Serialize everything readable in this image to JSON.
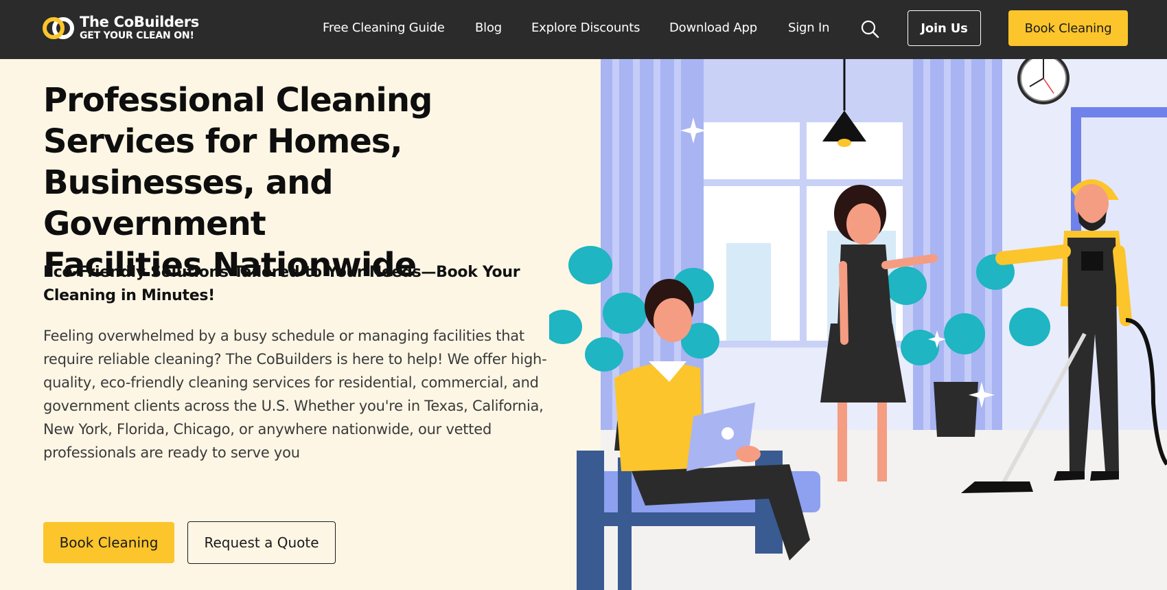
{
  "brand": {
    "name": "The CoBuilders",
    "tagline": "GET YOUR CLEAN ON!",
    "accent_color": "#fbc52b",
    "header_bg": "#2b2b2b",
    "page_bg": "#fdf6e5"
  },
  "nav": {
    "links": [
      "Free Cleaning Guide",
      "Blog",
      "Explore Discounts",
      "Download App",
      "Sign In"
    ],
    "search_icon": "search-icon",
    "join_label": "Join Us",
    "book_label": "Book Cleaning"
  },
  "hero": {
    "title_lines": [
      "Professional Cleaning",
      "Services for Homes,",
      "Businesses, and Government",
      "Facilities Nationwide"
    ],
    "subtitle": "Eco-Friendly Solutions Tailored to Your Needs—Book Your Cleaning in Minutes!",
    "body": "Feeling overwhelmed by a busy schedule or managing facilities that require reliable cleaning? The CoBuilders is here to help! We offer high-quality, eco-friendly cleaning services for residential, commercial, and government clients across the U.S. Whether you're in Texas, California, New York, Florida, Chicago, or anywhere nationwide, our vetted professionals are ready to serve you",
    "primary_button": "Book Cleaning",
    "secondary_button": "Request a Quote"
  }
}
